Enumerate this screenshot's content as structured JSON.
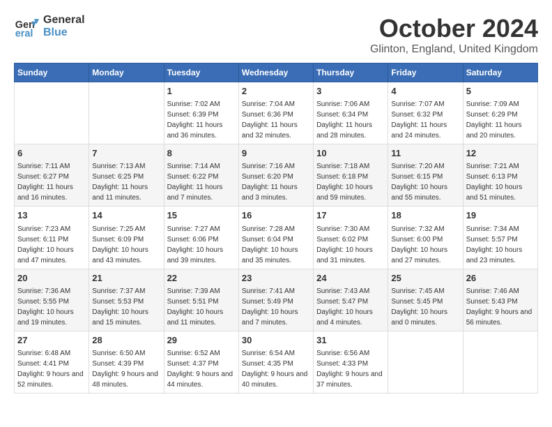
{
  "header": {
    "logo_line1": "General",
    "logo_line2": "Blue",
    "month": "October 2024",
    "location": "Glinton, England, United Kingdom"
  },
  "days_of_week": [
    "Sunday",
    "Monday",
    "Tuesday",
    "Wednesday",
    "Thursday",
    "Friday",
    "Saturday"
  ],
  "weeks": [
    [
      {
        "day": "",
        "info": ""
      },
      {
        "day": "",
        "info": ""
      },
      {
        "day": "1",
        "info": "Sunrise: 7:02 AM\nSunset: 6:39 PM\nDaylight: 11 hours and 36 minutes."
      },
      {
        "day": "2",
        "info": "Sunrise: 7:04 AM\nSunset: 6:36 PM\nDaylight: 11 hours and 32 minutes."
      },
      {
        "day": "3",
        "info": "Sunrise: 7:06 AM\nSunset: 6:34 PM\nDaylight: 11 hours and 28 minutes."
      },
      {
        "day": "4",
        "info": "Sunrise: 7:07 AM\nSunset: 6:32 PM\nDaylight: 11 hours and 24 minutes."
      },
      {
        "day": "5",
        "info": "Sunrise: 7:09 AM\nSunset: 6:29 PM\nDaylight: 11 hours and 20 minutes."
      }
    ],
    [
      {
        "day": "6",
        "info": "Sunrise: 7:11 AM\nSunset: 6:27 PM\nDaylight: 11 hours and 16 minutes."
      },
      {
        "day": "7",
        "info": "Sunrise: 7:13 AM\nSunset: 6:25 PM\nDaylight: 11 hours and 11 minutes."
      },
      {
        "day": "8",
        "info": "Sunrise: 7:14 AM\nSunset: 6:22 PM\nDaylight: 11 hours and 7 minutes."
      },
      {
        "day": "9",
        "info": "Sunrise: 7:16 AM\nSunset: 6:20 PM\nDaylight: 11 hours and 3 minutes."
      },
      {
        "day": "10",
        "info": "Sunrise: 7:18 AM\nSunset: 6:18 PM\nDaylight: 10 hours and 59 minutes."
      },
      {
        "day": "11",
        "info": "Sunrise: 7:20 AM\nSunset: 6:15 PM\nDaylight: 10 hours and 55 minutes."
      },
      {
        "day": "12",
        "info": "Sunrise: 7:21 AM\nSunset: 6:13 PM\nDaylight: 10 hours and 51 minutes."
      }
    ],
    [
      {
        "day": "13",
        "info": "Sunrise: 7:23 AM\nSunset: 6:11 PM\nDaylight: 10 hours and 47 minutes."
      },
      {
        "day": "14",
        "info": "Sunrise: 7:25 AM\nSunset: 6:09 PM\nDaylight: 10 hours and 43 minutes."
      },
      {
        "day": "15",
        "info": "Sunrise: 7:27 AM\nSunset: 6:06 PM\nDaylight: 10 hours and 39 minutes."
      },
      {
        "day": "16",
        "info": "Sunrise: 7:28 AM\nSunset: 6:04 PM\nDaylight: 10 hours and 35 minutes."
      },
      {
        "day": "17",
        "info": "Sunrise: 7:30 AM\nSunset: 6:02 PM\nDaylight: 10 hours and 31 minutes."
      },
      {
        "day": "18",
        "info": "Sunrise: 7:32 AM\nSunset: 6:00 PM\nDaylight: 10 hours and 27 minutes."
      },
      {
        "day": "19",
        "info": "Sunrise: 7:34 AM\nSunset: 5:57 PM\nDaylight: 10 hours and 23 minutes."
      }
    ],
    [
      {
        "day": "20",
        "info": "Sunrise: 7:36 AM\nSunset: 5:55 PM\nDaylight: 10 hours and 19 minutes."
      },
      {
        "day": "21",
        "info": "Sunrise: 7:37 AM\nSunset: 5:53 PM\nDaylight: 10 hours and 15 minutes."
      },
      {
        "day": "22",
        "info": "Sunrise: 7:39 AM\nSunset: 5:51 PM\nDaylight: 10 hours and 11 minutes."
      },
      {
        "day": "23",
        "info": "Sunrise: 7:41 AM\nSunset: 5:49 PM\nDaylight: 10 hours and 7 minutes."
      },
      {
        "day": "24",
        "info": "Sunrise: 7:43 AM\nSunset: 5:47 PM\nDaylight: 10 hours and 4 minutes."
      },
      {
        "day": "25",
        "info": "Sunrise: 7:45 AM\nSunset: 5:45 PM\nDaylight: 10 hours and 0 minutes."
      },
      {
        "day": "26",
        "info": "Sunrise: 7:46 AM\nSunset: 5:43 PM\nDaylight: 9 hours and 56 minutes."
      }
    ],
    [
      {
        "day": "27",
        "info": "Sunrise: 6:48 AM\nSunset: 4:41 PM\nDaylight: 9 hours and 52 minutes."
      },
      {
        "day": "28",
        "info": "Sunrise: 6:50 AM\nSunset: 4:39 PM\nDaylight: 9 hours and 48 minutes."
      },
      {
        "day": "29",
        "info": "Sunrise: 6:52 AM\nSunset: 4:37 PM\nDaylight: 9 hours and 44 minutes."
      },
      {
        "day": "30",
        "info": "Sunrise: 6:54 AM\nSunset: 4:35 PM\nDaylight: 9 hours and 40 minutes."
      },
      {
        "day": "31",
        "info": "Sunrise: 6:56 AM\nSunset: 4:33 PM\nDaylight: 9 hours and 37 minutes."
      },
      {
        "day": "",
        "info": ""
      },
      {
        "day": "",
        "info": ""
      }
    ]
  ]
}
